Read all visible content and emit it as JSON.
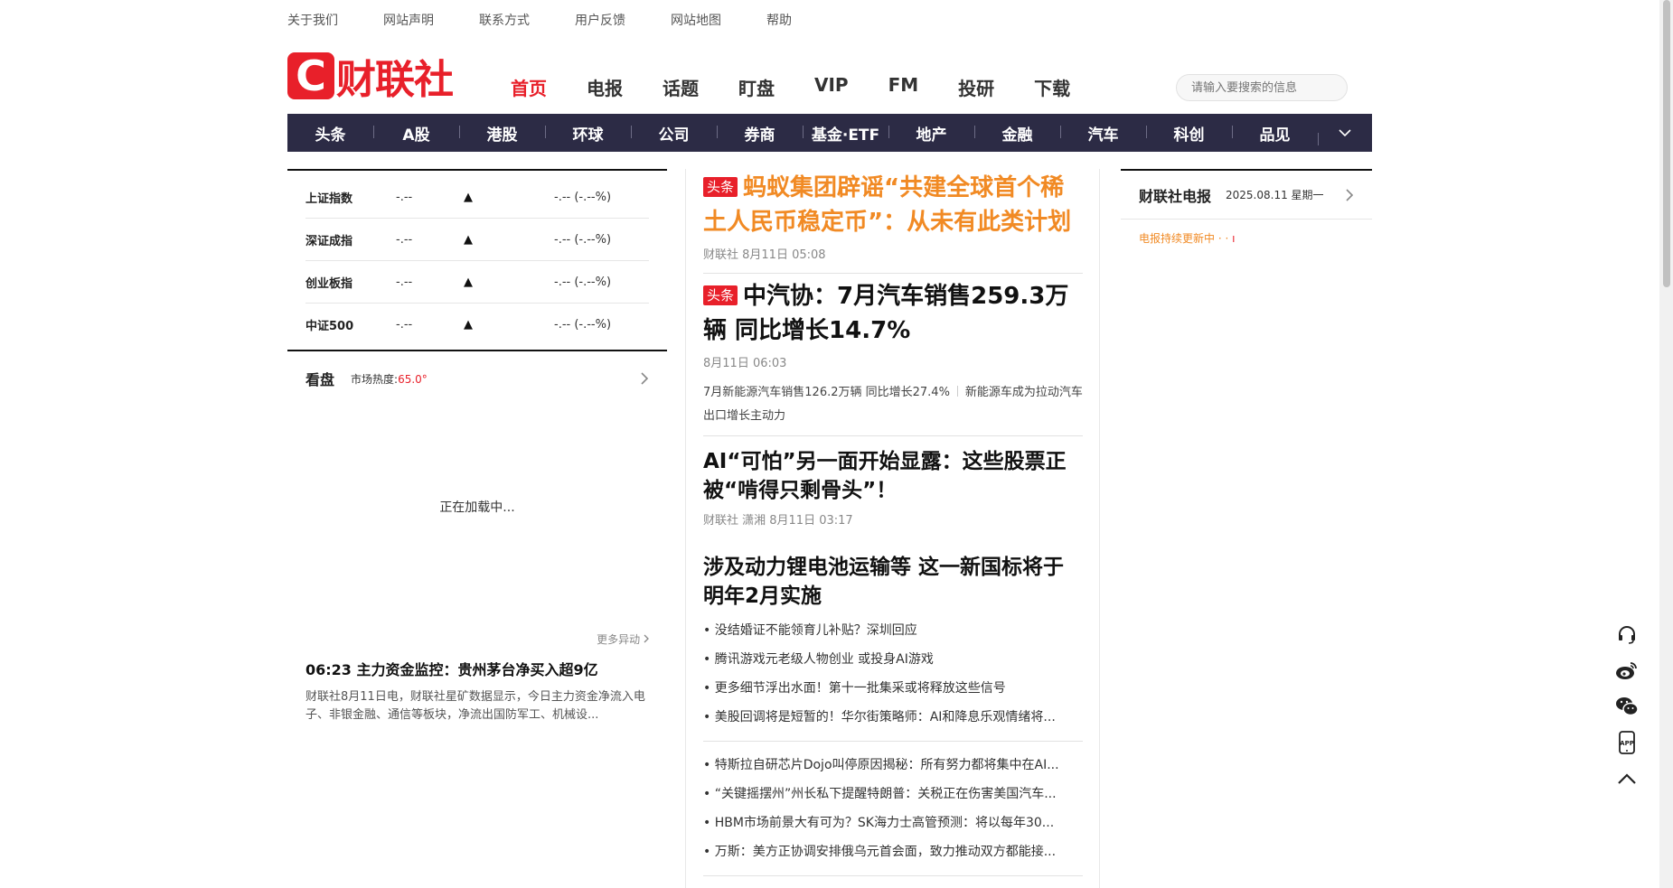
{
  "top_links": [
    "关于我们",
    "网站声明",
    "联系方式",
    "用户反馈",
    "网站地图",
    "帮助"
  ],
  "logo": {
    "mark": "C",
    "text": "财联社"
  },
  "main_nav": [
    {
      "label": "首页",
      "active": true
    },
    {
      "label": "电报"
    },
    {
      "label": "话题"
    },
    {
      "label": "盯盘"
    },
    {
      "label": "VIP"
    },
    {
      "label": "FM"
    },
    {
      "label": "投研"
    },
    {
      "label": "下载"
    }
  ],
  "search": {
    "placeholder": "请输入要搜索的信息"
  },
  "channels": [
    "头条",
    "A股",
    "港股",
    "环球",
    "公司",
    "券商",
    "基金·ETF",
    "地产",
    "金融",
    "汽车",
    "科创",
    "品见"
  ],
  "indices": [
    {
      "name": "上证指数",
      "value": "-.--",
      "arrow": "▲",
      "change": "-.--  (-.--%)"
    },
    {
      "name": "深证成指",
      "value": "-.--",
      "arrow": "▲",
      "change": "-.--  (-.--%)"
    },
    {
      "name": "创业板指",
      "value": "-.--",
      "arrow": "▲",
      "change": "-.--  (-.--%)"
    },
    {
      "name": "中证500",
      "value": "-.--",
      "arrow": "▲",
      "change": "-.--  (-.--%)"
    }
  ],
  "kanpan": {
    "title": "看盘",
    "heat_label": "市场热度:",
    "heat_value": "65.0°",
    "loading": "正在加载中...",
    "more": "更多异动"
  },
  "flash": {
    "title": "06:23 主力资金监控：贵州茅台净买入超9亿",
    "body": "财联社8月11日电，财联社星矿数据显示，今日主力资金净流入电子、非银金融、通信等板块，净流出国防军工、机械设..."
  },
  "center": {
    "tag": "头条",
    "headline1": "蚂蚁集团辟谣“共建全球首个稀土人民币稳定币”：从未有此类计划",
    "meta1": "财联社 8月11日 05:08",
    "headline2": "中汽协：7月汽车销售259.3万辆 同比增长14.7%",
    "meta2": "8月11日 06:03",
    "sub2a": "7月新能源汽车销售126.2万辆 同比增长27.4%",
    "sub2b": "新能源车成为拉动汽车出口增长主动力",
    "headline3": "AI“可怕”另一面开始显露：这些股票正被“啃得只剩骨头”！",
    "meta3": "财联社 潇湘 8月11日 03:17",
    "headline4": "涉及动力锂电池运输等 这一新国标将于明年2月实施",
    "bullets_a": [
      "• 没结婚证不能领育儿补贴？深圳回应",
      "• 腾讯游戏元老级人物创业 或投身AI游戏",
      "• 更多细节浮出水面！第十一批集采或将释放这些信号",
      "• 美股回调将是短暂的！华尔街策略师：AI和降息乐观情绪将..."
    ],
    "bullets_b": [
      "• 特斯拉自研芯片Dojo叫停原因揭秘：所有努力都将集中在AI...",
      "• “关键摇摆州”州长私下提醒特朗普：关税正在伤害美国汽车...",
      "• HBM市场前景大有可为？SK海力士高管预测：将以每年30...",
      "• 万斯：美方正协调安排俄乌元首会面，致力推动双方都能接..."
    ]
  },
  "telegraph": {
    "title": "财联社电报",
    "date": "2025.08.11 星期一",
    "update": "电报持续更新中"
  },
  "side_tools": [
    "headset-icon",
    "weibo-icon",
    "wechat-icon",
    "app-icon",
    "back-to-top-icon"
  ]
}
